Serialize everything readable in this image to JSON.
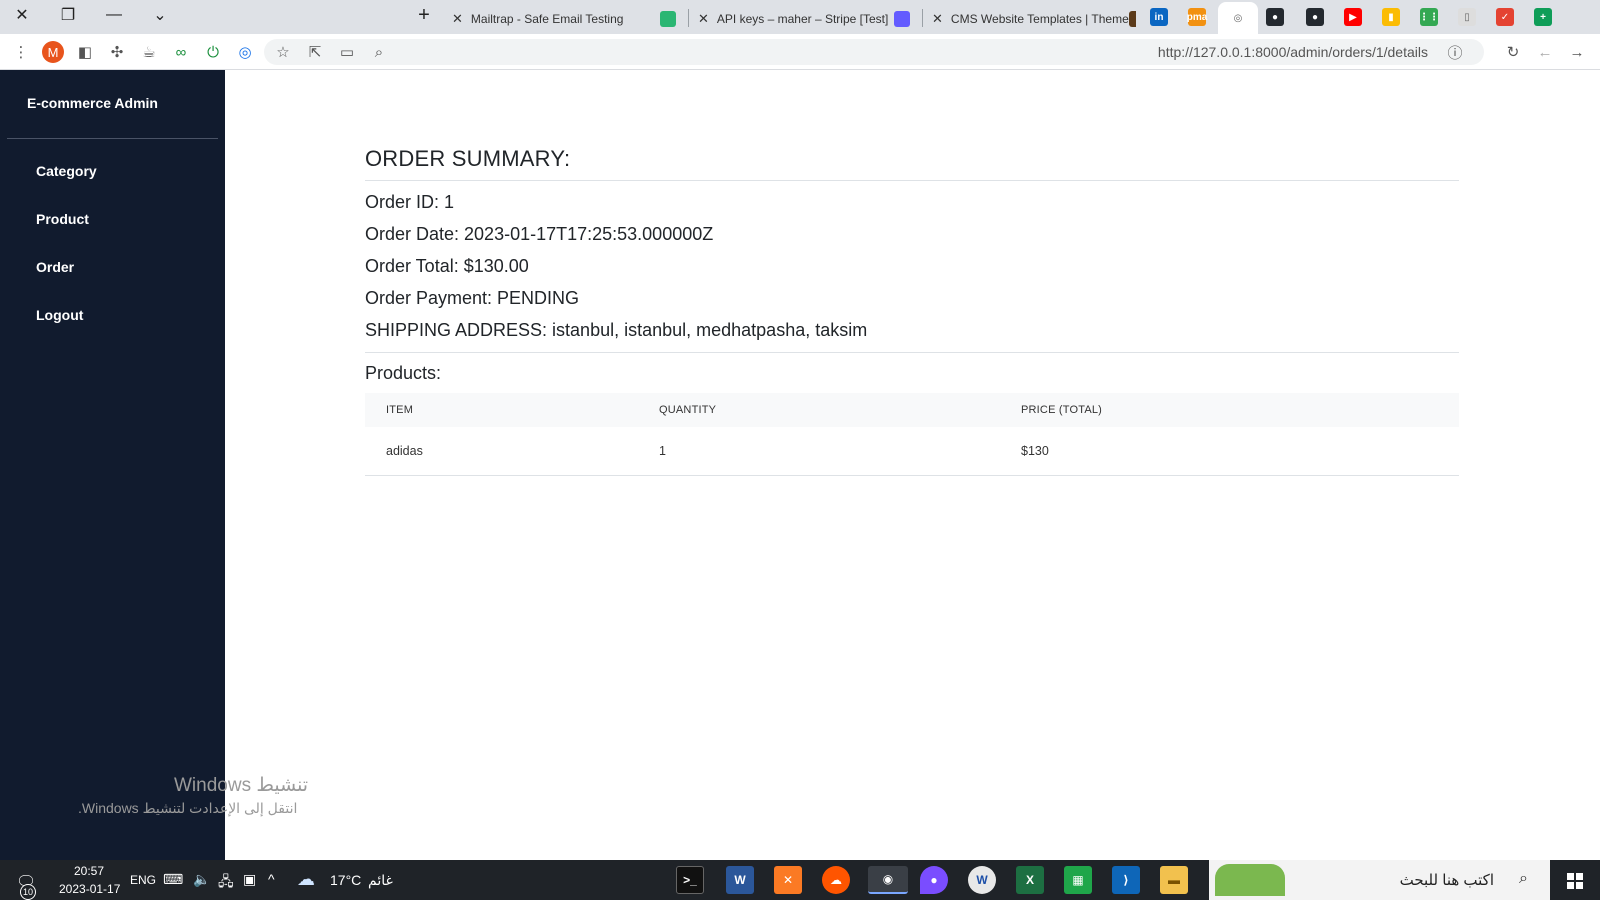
{
  "browser": {
    "tabs": [
      {
        "title": "Mailtrap - Safe Email Testing",
        "favicon_color": "#2bb673"
      },
      {
        "title": "API keys – maher – Stripe [Test]",
        "favicon_color": "#635bff"
      },
      {
        "title": "CMS Website Templates | Theme",
        "favicon_color": "#5b3a1a"
      }
    ],
    "pinned_tabs": [
      {
        "icon": "linkedin-icon",
        "label": "in",
        "color": "#0a66c2"
      },
      {
        "icon": "phpmyadmin-icon",
        "label": "pma",
        "color": "#f29111"
      },
      {
        "icon": "chrome-icon",
        "label": "◎",
        "color": "#ffffff"
      },
      {
        "icon": "github-icon",
        "label": "●",
        "color": "#24292f"
      },
      {
        "icon": "github-icon",
        "label": "●",
        "color": "#24292f"
      },
      {
        "icon": "youtube-icon",
        "label": "▶",
        "color": "#ff0000"
      },
      {
        "icon": "keep-icon",
        "label": "▮",
        "color": "#fbbc04"
      },
      {
        "icon": "apps-icon",
        "label": "⋮⋮",
        "color": "#34a853"
      },
      {
        "icon": "document-icon",
        "label": "▯",
        "color": "#dddddd"
      },
      {
        "icon": "todo-icon",
        "label": "✓",
        "color": "#e44332"
      },
      {
        "icon": "sheets-icon",
        "label": "+",
        "color": "#0f9d58"
      }
    ],
    "profile_initial": "M",
    "url": "http://127.0.0.1:8000/admin/orders/1/details"
  },
  "sidebar": {
    "brand": "E-commerce Admin",
    "items": [
      {
        "label": "Category"
      },
      {
        "label": "Product"
      },
      {
        "label": "Order"
      },
      {
        "label": "Logout"
      }
    ]
  },
  "order": {
    "heading": "ORDER SUMMARY:",
    "id_line": "Order ID: 1",
    "date_line": "Order Date: 2023-01-17T17:25:53.000000Z",
    "total_line": "Order Total: $130.00",
    "payment_line": "Order Payment: PENDING",
    "shipping_line": "SHIPPING ADDRESS: istanbul, istanbul, medhatpasha, taksim",
    "products_heading": "Products:",
    "table": {
      "headers": [
        "ITEM",
        "QUANTITY",
        "PRICE (TOTAL)"
      ],
      "rows": [
        [
          "adidas",
          "1",
          "$130"
        ]
      ]
    }
  },
  "watermark": {
    "line1": "تنشيط Windows",
    "line2": "انتقل إلى الإعدادت لتنشيط Windows."
  },
  "taskbar": {
    "time": "20:57",
    "date": "2023-01-17",
    "language": "ENG",
    "temperature": "17°C",
    "weather": "غائم",
    "notification_count": "10",
    "search_placeholder": "اكتب هنا للبحث"
  }
}
